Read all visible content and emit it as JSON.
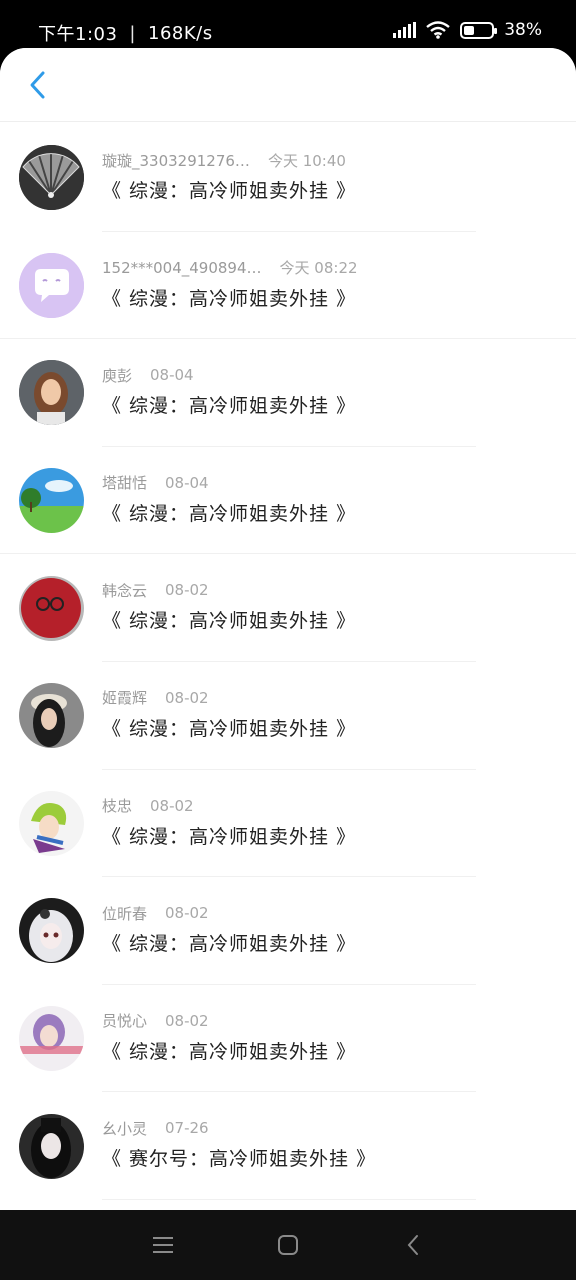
{
  "status_bar": {
    "time": "下午1:03",
    "separator": "|",
    "speed": "168K/s",
    "battery_text": "38%",
    "battery_level": 0.38
  },
  "header": {
    "back_icon": "chevron-left-icon",
    "accent": "#2f9be8"
  },
  "items": [
    {
      "name": "璇璇_3303291276…",
      "time": "今天 10:40",
      "title": "《 综漫：高冷师姐卖外挂 》",
      "avatar_icon": "fan-avatar-icon"
    },
    {
      "name": "152***004_490894…",
      "time": "今天 08:22",
      "title": "《 综漫：高冷师姐卖外挂 》",
      "avatar_icon": "chat-bubble-avatar-icon"
    },
    {
      "name": "庾彭",
      "time": "08-04",
      "title": "《 综漫：高冷师姐卖外挂 》",
      "avatar_icon": "woman-portrait-avatar-icon"
    },
    {
      "name": "塔甜恬",
      "time": "08-04",
      "title": "《 综漫：高冷师姐卖外挂 》",
      "avatar_icon": "landscape-avatar-icon"
    },
    {
      "name": "韩念云",
      "time": "08-02",
      "title": "《 综漫：高冷师姐卖外挂 》",
      "avatar_icon": "red-ball-avatar-icon"
    },
    {
      "name": "姬霞辉",
      "time": "08-02",
      "title": "《 综漫：高冷师姐卖外挂 》",
      "avatar_icon": "girl-cap-avatar-icon"
    },
    {
      "name": "枝忠",
      "time": "08-02",
      "title": "《 综漫：高冷师姐卖外挂 》",
      "avatar_icon": "anime-boy-avatar-icon"
    },
    {
      "name": "位昕春",
      "time": "08-02",
      "title": "《 综漫：高冷师姐卖外挂 》",
      "avatar_icon": "anime-girl-avatar-icon"
    },
    {
      "name": "员悦心",
      "time": "08-02",
      "title": "《 综漫：高冷师姐卖外挂 》",
      "avatar_icon": "purple-hair-avatar-icon"
    },
    {
      "name": "幺小灵",
      "time": "07-26",
      "title": "《 赛尔号：高冷师姐卖外挂 》",
      "avatar_icon": "dark-portrait-avatar-icon"
    }
  ],
  "nav_bar": {
    "menu_icon": "menu-icon",
    "home_icon": "home-icon",
    "back_icon": "back-icon"
  }
}
